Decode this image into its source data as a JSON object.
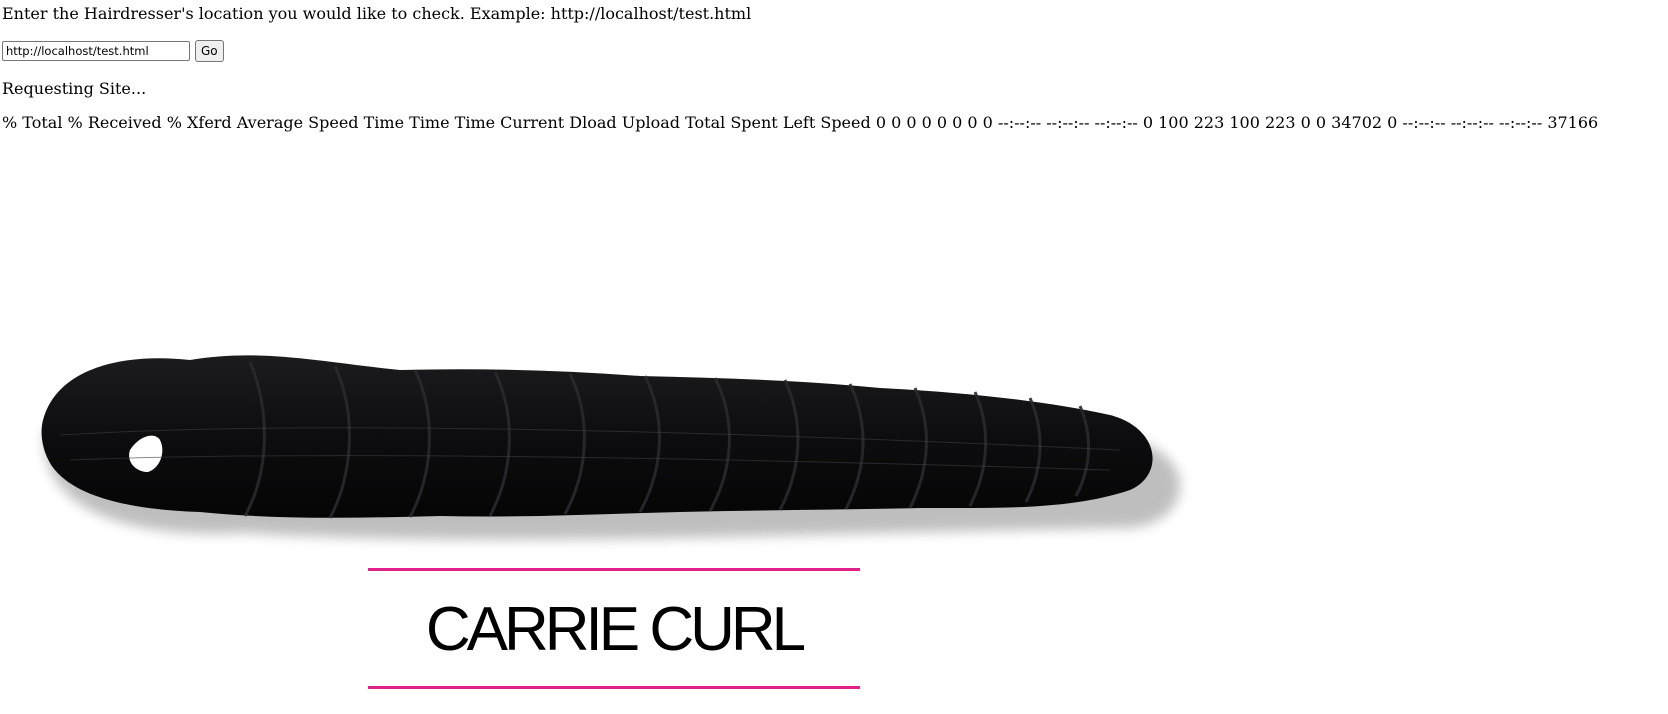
{
  "prompt": {
    "text": "Enter the Hairdresser's location you would like to check. Example: http://localhost/test.html"
  },
  "form": {
    "url_value": "http://localhost/test.html",
    "go_label": "Go"
  },
  "status": {
    "text": "Requesting Site..."
  },
  "curl_output": {
    "text": "% Total % Received % Xferd Average Speed Time Time Time Current Dload Upload Total Spent Left Speed 0 0 0 0 0 0 0 0 --:--:-- --:--:-- --:--:-- 0 100 223 100 223 0 0 34702 0 --:--:-- --:--:-- --:--:-- 37166"
  },
  "product": {
    "title": "CARRIE CURL",
    "accent_color": "#e0218a",
    "hair_color": "#0d0d0f"
  }
}
